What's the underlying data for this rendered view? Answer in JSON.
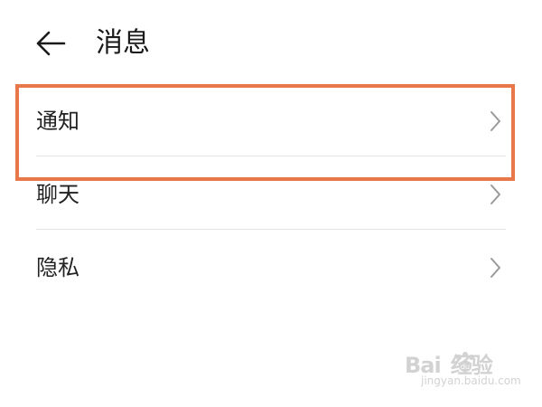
{
  "header": {
    "back_icon": "arrow-left-icon",
    "title": "消息"
  },
  "menu": {
    "items": [
      {
        "label": "通知",
        "icon": "chevron-right-icon"
      },
      {
        "label": "聊天",
        "icon": "chevron-right-icon"
      },
      {
        "label": "隐私",
        "icon": "chevron-right-icon"
      }
    ]
  },
  "annotation": {
    "highlight_color": "#e8774a",
    "highlighted_item": "通知"
  },
  "watermark": {
    "logo_text": "Bai 经验",
    "sub_text": "jingyan.baidu.com"
  }
}
